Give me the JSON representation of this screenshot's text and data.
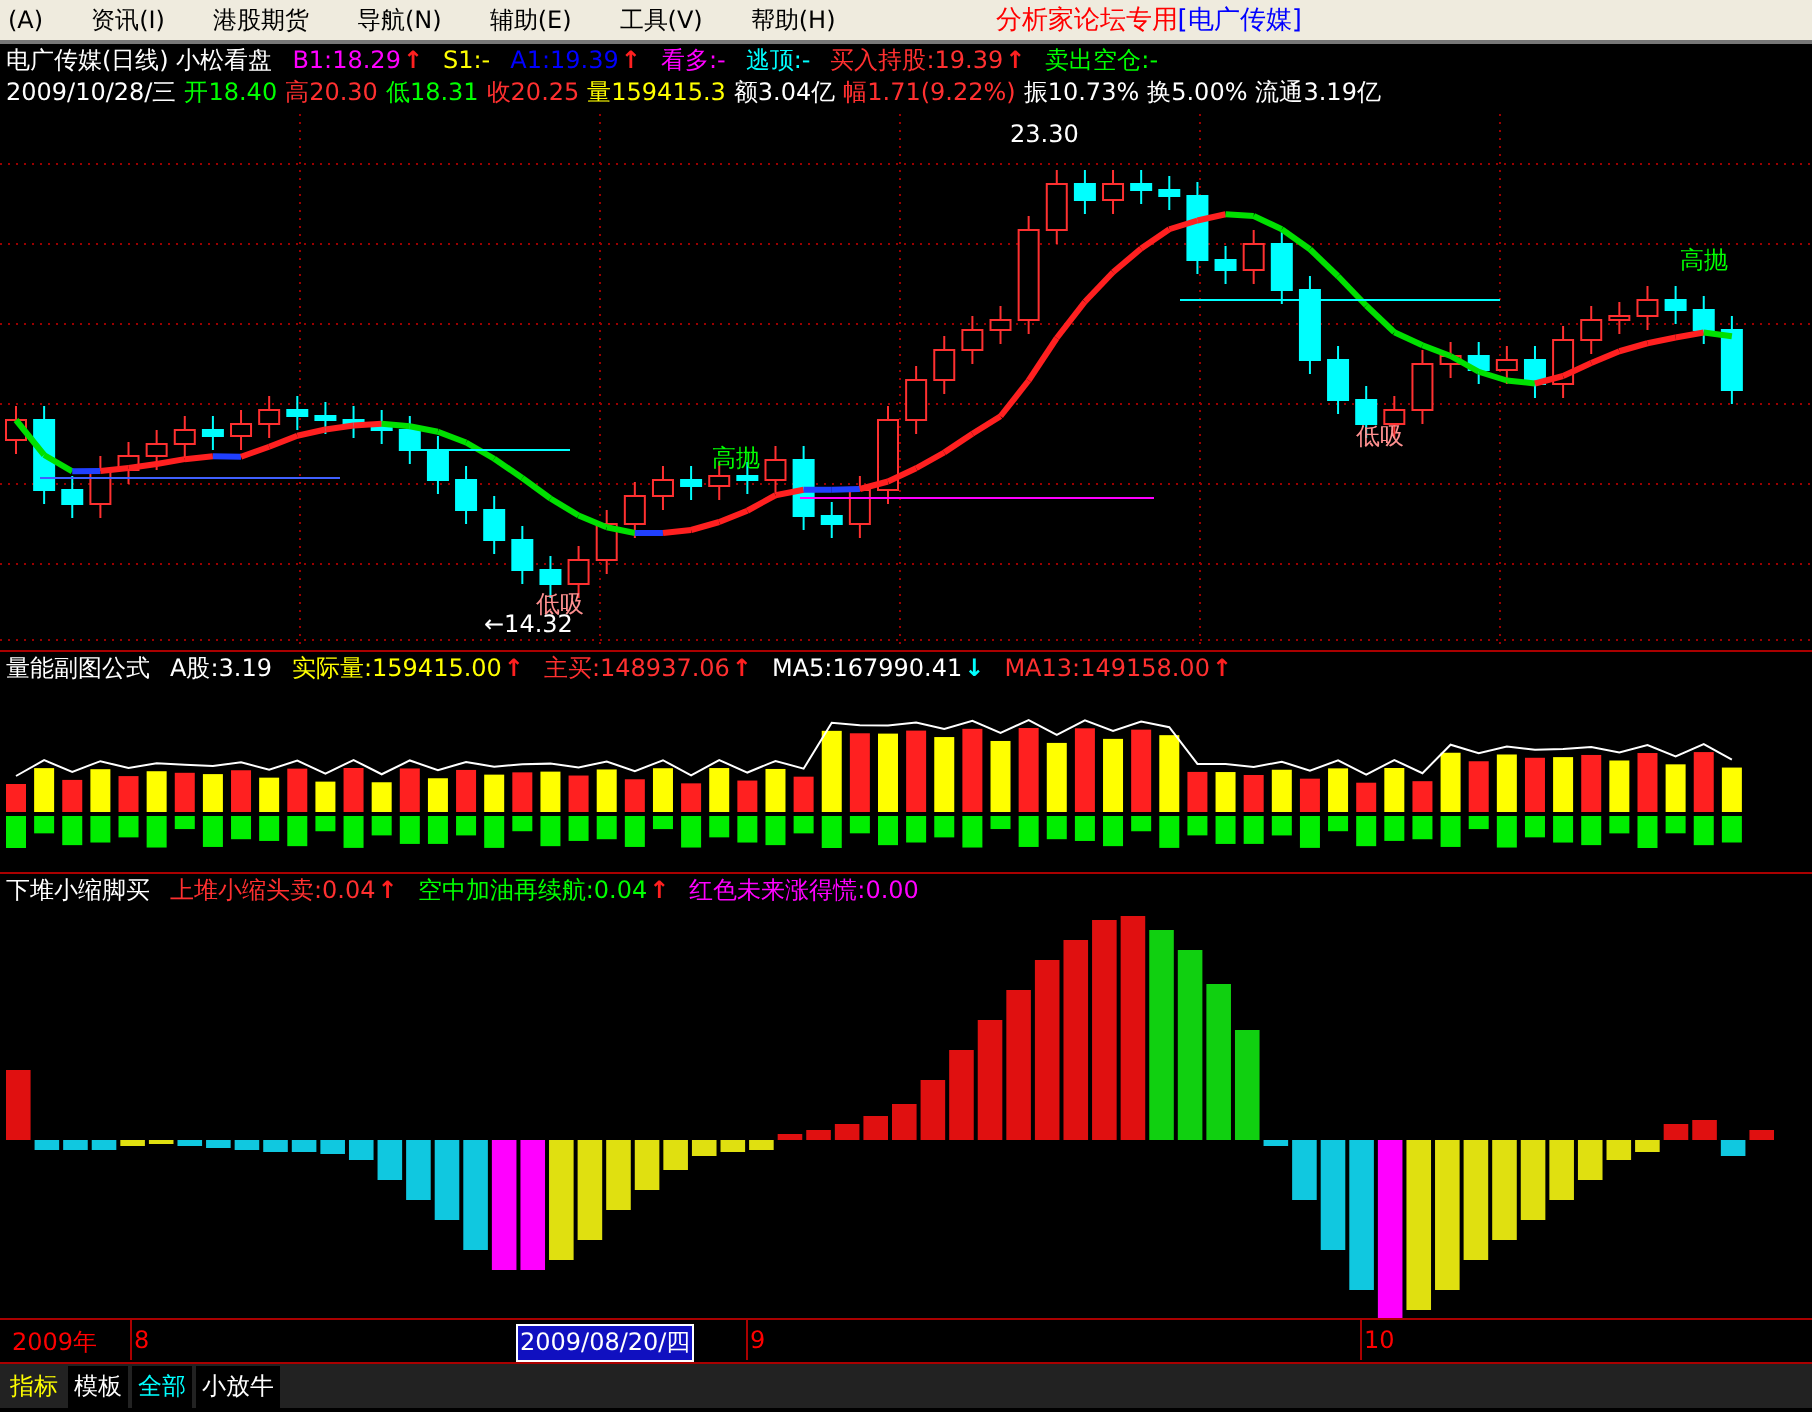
{
  "menu_bar": {
    "items": [
      "(A)",
      "资讯(I)",
      "港股期货",
      "导航(N)",
      "辅助(E)",
      "工具(V)",
      "帮助(H)"
    ],
    "title": "分析家论坛专用",
    "title_stock": "[电广传媒]"
  },
  "main_chart": {
    "header_line1": [
      {
        "text": "电广传媒(日线) 小松看盘",
        "color": "#ffffff"
      },
      {
        "text": "B1:18.29",
        "color": "#ff00ff",
        "arrow": {
          "text": "↑",
          "color": "#ff2020"
        }
      },
      {
        "text": "S1:-",
        "color": "#ffff00"
      },
      {
        "text": "A1:19.39",
        "color": "#0000ff",
        "arrow": {
          "text": "↑",
          "color": "#ff2020"
        }
      },
      {
        "text": "看多:-",
        "color": "#ff00ff"
      },
      {
        "text": "逃顶:-",
        "color": "#00ffff"
      },
      {
        "text": "买入持股:19.39",
        "color": "#ff3030",
        "arrow": {
          "text": "↑",
          "color": "#ff2020"
        }
      },
      {
        "text": "卖出空仓:-",
        "color": "#00ff00"
      }
    ],
    "header_line2": [
      {
        "text": "2009/10/28/三",
        "color": "#ffffff"
      },
      {
        "text": "开18.40",
        "color": "#00ff00"
      },
      {
        "text": "高20.30",
        "color": "#ff3030"
      },
      {
        "text": "低18.31",
        "color": "#00ff00"
      },
      {
        "text": "收20.25",
        "color": "#ff3030"
      },
      {
        "text": "量159415.3",
        "color": "#ffff00"
      },
      {
        "text": "额3.04亿",
        "color": "#ffffff"
      },
      {
        "text": "幅1.71(9.22%)",
        "color": "#ff3030"
      },
      {
        "text": "振10.73%",
        "color": "#ffffff"
      },
      {
        "text": "换5.00%",
        "color": "#ffffff"
      },
      {
        "text": "流通3.19亿",
        "color": "#ffffff"
      }
    ],
    "labels": [
      {
        "text": "高抛",
        "kind": "sell"
      },
      {
        "text": "低吸",
        "kind": "buy"
      },
      {
        "text": "←14.32",
        "kind": "price"
      },
      {
        "text": "23.30",
        "kind": "price"
      },
      {
        "text": "低吸",
        "kind": "buy"
      },
      {
        "text": "高抛",
        "kind": "sell"
      }
    ]
  },
  "volume_panel": {
    "header": [
      {
        "text": "量能副图公式",
        "color": "#ffffff"
      },
      {
        "text": "A股:3.19",
        "color": "#ffffff"
      },
      {
        "text": "实际量:159415.00",
        "color": "#ffff00",
        "arrow": {
          "text": "↑",
          "color": "#ff2020"
        }
      },
      {
        "text": "主买:148937.06",
        "color": "#ff3030",
        "arrow": {
          "text": "↑",
          "color": "#ff2020"
        }
      },
      {
        "text": "MA5:167990.41",
        "color": "#ffffff",
        "arrow": {
          "text": "↓",
          "color": "#00ffff"
        }
      },
      {
        "text": "MA13:149158.00",
        "color": "#ff3030",
        "arrow": {
          "text": "↑",
          "color": "#ff2020"
        }
      }
    ]
  },
  "indicator_panel": {
    "header": [
      {
        "text": "下堆小缩脚买",
        "color": "#ffffff"
      },
      {
        "text": "上堆小缩头卖:0.04",
        "color": "#ff3030",
        "arrow": {
          "text": "↑",
          "color": "#ff2020"
        }
      },
      {
        "text": "空中加油再续航:0.04",
        "color": "#00ff00",
        "arrow": {
          "text": "↑",
          "color": "#ff2020"
        }
      },
      {
        "text": "红色未来涨得慌:0.00",
        "color": "#ff00ff"
      }
    ]
  },
  "time_axis": {
    "year": "2009年",
    "months": [
      "8",
      "9",
      "10"
    ],
    "cursor_date": "2009/08/20/四"
  },
  "bottom_bar": {
    "label": "指标",
    "tabs": [
      {
        "label": "模板",
        "selected": false
      },
      {
        "label": "全部",
        "selected": true
      },
      {
        "label": "小放牛",
        "selected": false
      }
    ]
  }
}
